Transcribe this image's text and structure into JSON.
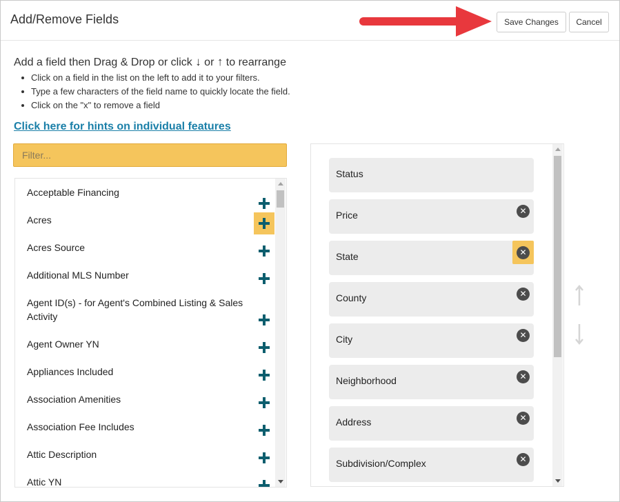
{
  "header": {
    "title": "Add/Remove Fields",
    "save_label": "Save Changes",
    "cancel_label": "Cancel"
  },
  "instructions": {
    "title_part1": "Add a field then Drag & Drop or click ",
    "down_glyph": "↓",
    "or_text": " or ",
    "up_glyph": "↑",
    "title_part2": " to rearrange",
    "bullets": [
      "Click on a field in the list on the left to add it to your filters.",
      "Type a few characters of the field name to quickly locate the field.",
      "Click on the \"x\" to remove a field"
    ]
  },
  "hints_link": "Click here for hints on individual features",
  "filter": {
    "placeholder": "Filter...",
    "value": ""
  },
  "available_fields": [
    "Acceptable Financing",
    "Acres",
    "Acres Source",
    "Additional MLS Number",
    "Agent ID(s) - for Agent's Combined Listing & Sales Activity",
    "Agent Owner YN",
    "Appliances Included",
    "Association Amenities",
    "Association Fee Includes",
    "Attic Description",
    "Attic YN"
  ],
  "selected_fields": [
    "Status",
    "Price",
    "State",
    "County",
    "City",
    "Neighborhood",
    "Address",
    "Subdivision/Complex"
  ],
  "colors": {
    "highlight": "#f5c55c",
    "plus_icon": "#0d5e6e",
    "link": "#1a7fa8",
    "arrow": "#e8383d"
  },
  "icons": {
    "add": "plus-icon",
    "remove": "remove-x-icon",
    "move_up": "move-up-arrow-icon",
    "move_down": "move-down-arrow-icon",
    "callout": "red-arrow-icon"
  }
}
